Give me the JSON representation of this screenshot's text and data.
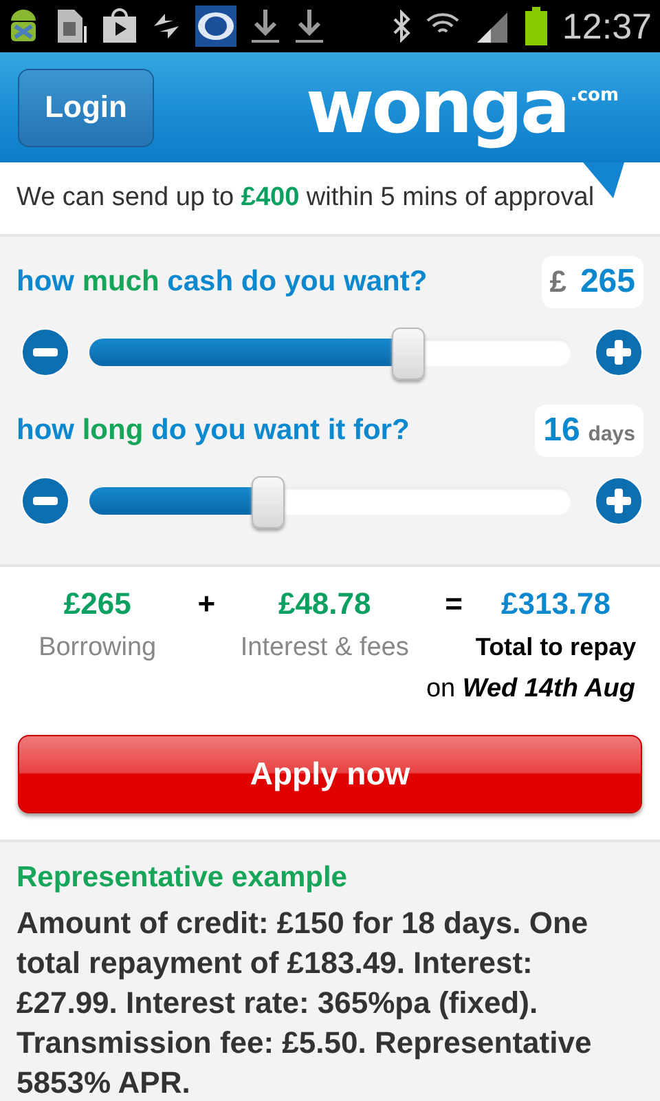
{
  "status_bar": {
    "time": "12:37"
  },
  "header": {
    "login": "Login",
    "logo": "wonga",
    "logo_suffix": ".com"
  },
  "tagline": [
    {
      "text": "We can send up to ",
      "accent": false
    },
    {
      "text": "£400",
      "accent": true
    },
    {
      "text": " within 5 mins of approval",
      "accent": false
    }
  ],
  "sliders": [
    {
      "question": [
        {
          "text": "how ",
          "accent": false
        },
        {
          "text": "much",
          "accent": true
        },
        {
          "text": " cash do you want?",
          "accent": false
        }
      ],
      "prefix": "£",
      "value": "265",
      "level": 0.66
    },
    {
      "question": [
        {
          "text": "how ",
          "accent": false
        },
        {
          "text": "long",
          "accent": true
        },
        {
          "text": " do you want it for?",
          "accent": false
        }
      ],
      "value": "16",
      "unit": "days",
      "level": 0.37
    }
  ],
  "summary": {
    "borrowing": {
      "amount": "£265",
      "label": "Borrowing"
    },
    "plus": "+",
    "interest": {
      "amount": "£48.78",
      "label": "Interest & fees"
    },
    "equals": "=",
    "total": {
      "amount": "£313.78",
      "label": "Total to repay"
    },
    "due": "on *Wed 14th Aug*"
  },
  "apply_button": "Apply now",
  "representative": {
    "title": "Representative example",
    "body": "Amount of credit: £150 for 18 days. One total repayment of £183.49. Interest: £27.99. Interest rate: 365%pa (fixed). Transmission fee: £5.50. Representative 5853% APR."
  }
}
